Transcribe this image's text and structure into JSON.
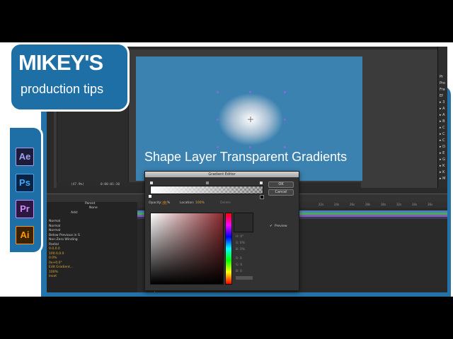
{
  "overlay_title": "Shape Layer Transparent Gradients",
  "logo": {
    "title": "MIKEY'S",
    "subtitle": "production tips"
  },
  "apps": [
    {
      "label": "Ae",
      "bg": "#1b1b3a",
      "fg": "#a79ef0",
      "icon": "after-effects-icon"
    },
    {
      "label": "Ps",
      "bg": "#0b2240",
      "fg": "#40a9ff",
      "icon": "photoshop-icon"
    },
    {
      "label": "Pr",
      "bg": "#2a1840",
      "fg": "#d08cff",
      "icon": "premiere-icon"
    },
    {
      "label": "Ai",
      "bg": "#3a2200",
      "fg": "#ff9a00",
      "icon": "illustrator-icon"
    }
  ],
  "gradient_editor": {
    "title": "Gradient Editor",
    "ok": "OK",
    "cancel": "Cancel",
    "opacity_label": "Opacity:",
    "opacity_value": "0",
    "opacity_unit": "%",
    "location_label": "Location:",
    "location_value": "100%",
    "delete_label": "Delete",
    "preview_label": "Preview",
    "fields": [
      "H: 0°",
      "S: 0%",
      "B: 0%",
      "R: 0",
      "G: 0",
      "B: 0"
    ]
  },
  "timeline": {
    "comp_time": "0:00:01:10",
    "zoom": "(47.9%)",
    "add_label": "Add:",
    "parent_label": "Parent",
    "parent_value": "None",
    "ruler_ticks": [
      "22s",
      "24s",
      "26s",
      "28s",
      "30s",
      "32s",
      "34s",
      "36s"
    ],
    "layer_props": [
      {
        "text": "Normal",
        "yellow": false
      },
      {
        "text": "Normal",
        "yellow": false
      },
      {
        "text": "Normal",
        "yellow": false
      },
      {
        "text": "Below Previous in S",
        "yellow": false
      },
      {
        "text": "Non-Zero Winding",
        "yellow": false
      },
      {
        "text": "Radial",
        "yellow": false
      },
      {
        "text": "0.0,0.0",
        "yellow": true
      },
      {
        "text": "100.0,0.0",
        "yellow": true
      },
      {
        "text": "0.0%",
        "yellow": true
      },
      {
        "text": "0x+0.0°",
        "yellow": true
      },
      {
        "text": "Edit Gradient...",
        "yellow": true
      },
      {
        "text": "100%",
        "yellow": true
      },
      {
        "text": "Inset",
        "yellow": true
      }
    ]
  },
  "right_panel": [
    "Pr",
    "Pro",
    "Fra",
    "Ef",
    "▸ 3",
    "▸ A",
    "▸ A",
    "▸ B",
    "▸ C",
    "▸ C",
    "▸ C",
    "▸ D",
    "▸ E",
    "▸ G",
    "▸ K",
    "▸ K",
    "▸ M"
  ]
}
